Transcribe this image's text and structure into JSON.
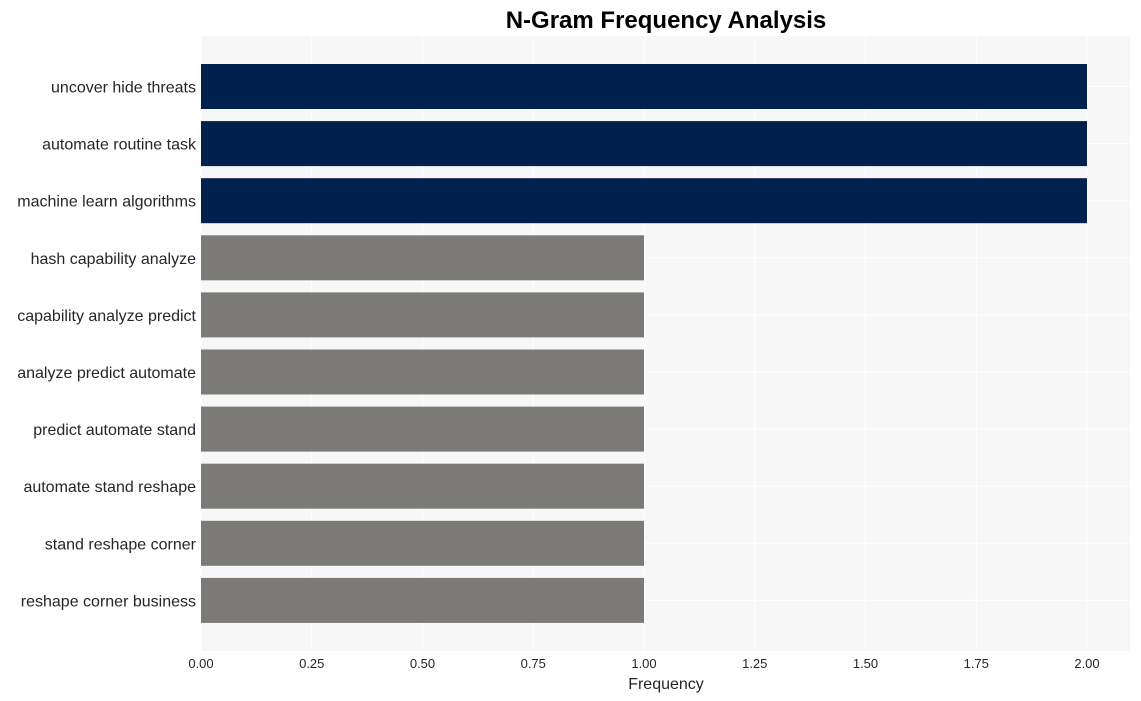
{
  "chart_data": {
    "type": "bar",
    "orientation": "horizontal",
    "title": "N-Gram Frequency Analysis",
    "xlabel": "Frequency",
    "ylabel": "",
    "xlim": [
      0,
      2.1
    ],
    "x_ticks": [
      "0.00",
      "0.25",
      "0.50",
      "0.75",
      "1.00",
      "1.25",
      "1.50",
      "1.75",
      "2.00"
    ],
    "grid": true,
    "legend": "none",
    "categories": [
      "uncover hide threats",
      "automate routine task",
      "machine learn algorithms",
      "hash capability analyze",
      "capability analyze predict",
      "analyze predict automate",
      "predict automate stand",
      "automate stand reshape",
      "stand reshape corner",
      "reshape corner business"
    ],
    "values": [
      2,
      2,
      2,
      1,
      1,
      1,
      1,
      1,
      1,
      1
    ],
    "colors": {
      "highlight": "#00204e",
      "default": "#7b7a76",
      "plot_background": "#f7f7f7",
      "grid": "#ffffff"
    }
  }
}
